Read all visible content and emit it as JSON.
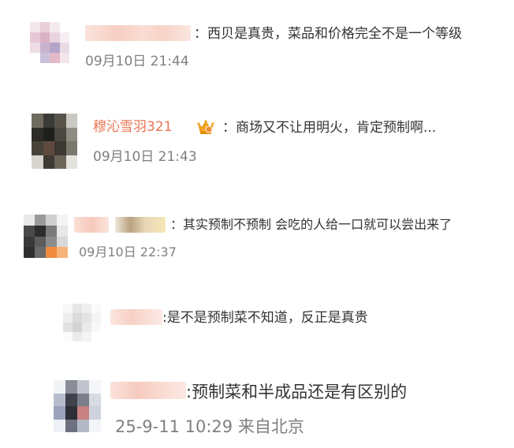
{
  "comments": [
    {
      "author": "",
      "text": "：西贝是真贵，菜品和价格完全不是一个等级",
      "meta": "09月10日 21:44"
    },
    {
      "author": "穆沁雪羽321",
      "badge_icon": "vip-crown-icon",
      "text": "：商场又不让用明火，肯定预制啊...",
      "meta": "09月10日 21:43"
    },
    {
      "author": "",
      "text": "：其实预制不预制 会吃的人给一口就可以尝出来了",
      "meta": "09月10日 22:37"
    },
    {
      "author": "",
      "text": ":是不是预制菜不知道，反正是真贵",
      "meta": ""
    },
    {
      "author": "",
      "text": ":预制菜和半成品还是有区别的",
      "meta": "25-9-11 10:29 来自北京"
    }
  ],
  "colors": {
    "author": "#eb7350",
    "text": "#333333",
    "meta": "#808080",
    "badge": "#f5a623"
  }
}
